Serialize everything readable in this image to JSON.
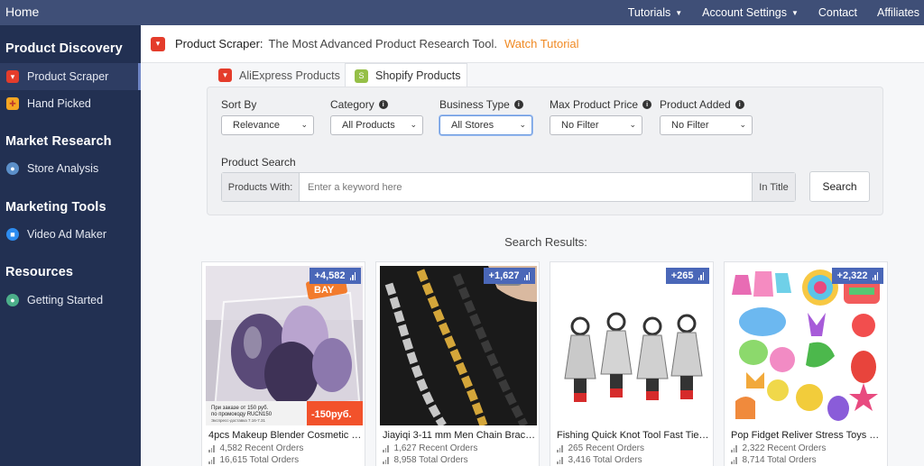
{
  "topbar": {
    "home": "Home",
    "nav": [
      {
        "label": "Tutorials",
        "dropdown": true
      },
      {
        "label": "Account Settings",
        "dropdown": true
      },
      {
        "label": "Contact",
        "dropdown": false
      },
      {
        "label": "Affiliates",
        "dropdown": false
      }
    ]
  },
  "sidebar": {
    "sections": [
      {
        "heading": "Product Discovery",
        "items": [
          {
            "label": "Product Scraper",
            "icon": "aliexpress-icon",
            "active": true
          },
          {
            "label": "Hand Picked",
            "icon": "gift-icon",
            "active": false
          }
        ]
      },
      {
        "heading": "Market Research",
        "items": [
          {
            "label": "Store Analysis",
            "icon": "store-analysis-icon",
            "active": false
          }
        ]
      },
      {
        "heading": "Marketing Tools",
        "items": [
          {
            "label": "Video Ad Maker",
            "icon": "video-camera-icon",
            "active": false
          }
        ]
      },
      {
        "heading": "Resources",
        "items": [
          {
            "label": "Getting Started",
            "icon": "getting-started-icon",
            "active": false
          }
        ]
      }
    ]
  },
  "header": {
    "title": "Product Scraper:",
    "subtitle": "The Most Advanced Product Research Tool.",
    "tutorial_link": "Watch Tutorial"
  },
  "tabs": [
    {
      "label": "AliExpress Products",
      "active": false
    },
    {
      "label": "Shopify Products",
      "active": true
    }
  ],
  "filters": {
    "sort_by": {
      "label": "Sort By",
      "value": "Relevance"
    },
    "category": {
      "label": "Category",
      "value": "All Products"
    },
    "business_type": {
      "label": "Business Type",
      "value": "All Stores"
    },
    "max_price": {
      "label": "Max Product Price",
      "value": "No Filter"
    },
    "product_added": {
      "label": "Product Added",
      "value": "No Filter"
    }
  },
  "search": {
    "label": "Product Search",
    "prefix": "Products With:",
    "placeholder": "Enter a keyword here",
    "suffix": "In Title",
    "button": "Search"
  },
  "results": {
    "title": "Search Results:",
    "products": [
      {
        "badge": "+4,582",
        "name": "4pcs Makeup Blender Cosmetic Pu...",
        "recent": "4,582 Recent Orders",
        "total": "16,615 Total Orders",
        "image_text": [
          "BAY",
          "При заказе от 150 руб.",
          "по промокоду RUCN150",
          "Экспресс-доставка 7.16-7.31",
          "-150руб."
        ]
      },
      {
        "badge": "+1,627",
        "name": "Jiayiqi 3-11 mm Men Chain Bracel...",
        "recent": "1,627 Recent Orders",
        "total": "8,958 Total Orders"
      },
      {
        "badge": "+265",
        "name": "Fishing Quick Knot Tool Fast Tie N...",
        "recent": "265 Recent Orders",
        "total": "3,416 Total Orders"
      },
      {
        "badge": "+2,322",
        "name": "Pop Fidget Reliver Stress Toys Pop...",
        "recent": "2,322 Recent Orders",
        "total": "8,714 Total Orders"
      }
    ]
  },
  "colors": {
    "topbar": "#3f4f77",
    "sidebar": "#223052",
    "accent_orange": "#f08a24",
    "badge": "#4a67b8",
    "aliexpress_red": "#e43c2b",
    "shopify_green": "#95bf47"
  }
}
